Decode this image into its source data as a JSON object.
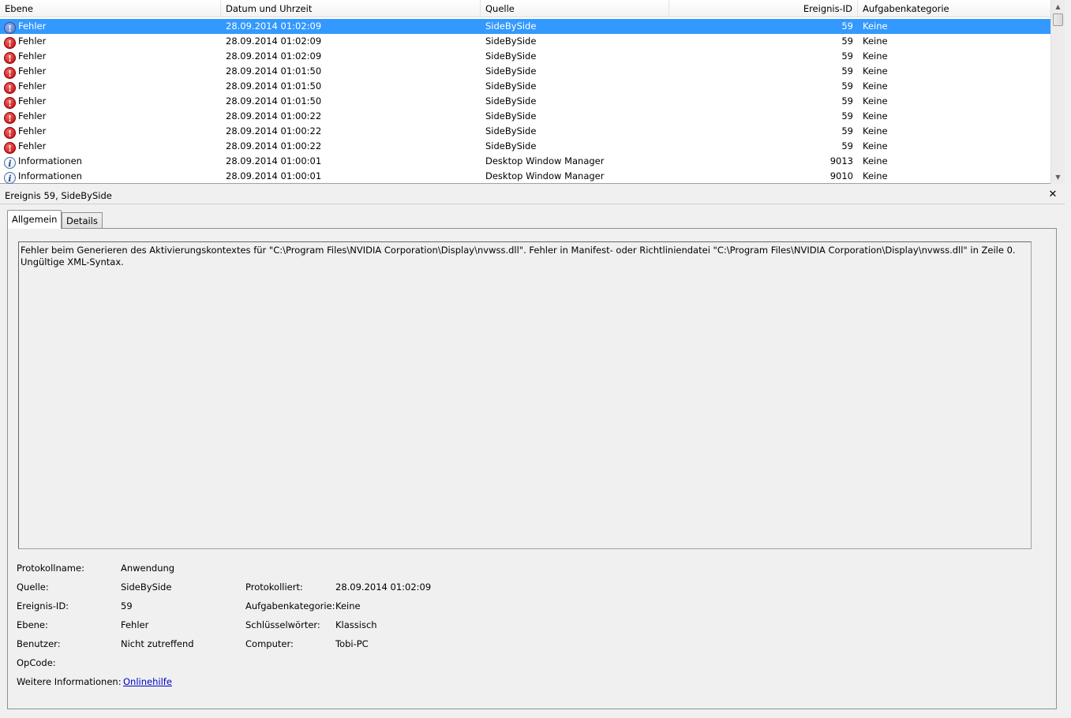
{
  "list": {
    "columns": {
      "level": "Ebene",
      "date": "Datum und Uhrzeit",
      "source": "Quelle",
      "event_id": "Ereignis-ID",
      "category": "Aufgabenkategorie"
    },
    "rows": [
      {
        "level": "Fehler",
        "type": "error",
        "date": "28.09.2014 01:02:09",
        "source": "SideBySide",
        "event_id": "59",
        "category": "Keine",
        "selected": true
      },
      {
        "level": "Fehler",
        "type": "error",
        "date": "28.09.2014 01:02:09",
        "source": "SideBySide",
        "event_id": "59",
        "category": "Keine"
      },
      {
        "level": "Fehler",
        "type": "error",
        "date": "28.09.2014 01:02:09",
        "source": "SideBySide",
        "event_id": "59",
        "category": "Keine"
      },
      {
        "level": "Fehler",
        "type": "error",
        "date": "28.09.2014 01:01:50",
        "source": "SideBySide",
        "event_id": "59",
        "category": "Keine"
      },
      {
        "level": "Fehler",
        "type": "error",
        "date": "28.09.2014 01:01:50",
        "source": "SideBySide",
        "event_id": "59",
        "category": "Keine"
      },
      {
        "level": "Fehler",
        "type": "error",
        "date": "28.09.2014 01:01:50",
        "source": "SideBySide",
        "event_id": "59",
        "category": "Keine"
      },
      {
        "level": "Fehler",
        "type": "error",
        "date": "28.09.2014 01:00:22",
        "source": "SideBySide",
        "event_id": "59",
        "category": "Keine"
      },
      {
        "level": "Fehler",
        "type": "error",
        "date": "28.09.2014 01:00:22",
        "source": "SideBySide",
        "event_id": "59",
        "category": "Keine"
      },
      {
        "level": "Fehler",
        "type": "error",
        "date": "28.09.2014 01:00:22",
        "source": "SideBySide",
        "event_id": "59",
        "category": "Keine"
      },
      {
        "level": "Informationen",
        "type": "info",
        "date": "28.09.2014 01:00:01",
        "source": "Desktop Window Manager",
        "event_id": "9013",
        "category": "Keine"
      },
      {
        "level": "Informationen",
        "type": "info",
        "date": "28.09.2014 01:00:01",
        "source": "Desktop Window Manager",
        "event_id": "9010",
        "category": "Keine"
      }
    ],
    "icons": {
      "error": "error-icon",
      "info": "info-icon"
    }
  },
  "detail": {
    "title": "Ereignis 59, SideBySide",
    "close_icon": "close-icon",
    "tabs": {
      "general": "Allgemein",
      "details": "Details"
    },
    "message": "Fehler beim Generieren des Aktivierungskontextes für \"C:\\Program Files\\NVIDIA Corporation\\Display\\nvwss.dll\". Fehler in Manifest- oder Richtliniendatei \"C:\\Program Files\\NVIDIA Corporation\\Display\\nvwss.dll\" in Zeile 0. Ungültige XML-Syntax.",
    "fields": {
      "log_name_label": "Protokollname:",
      "log_name": "Anwendung",
      "source_label": "Quelle:",
      "source": "SideBySide",
      "logged_label": "Protokolliert:",
      "logged": "28.09.2014 01:02:09",
      "event_id_label": "Ereignis-ID:",
      "event_id": "59",
      "category_label": "Aufgabenkategorie:",
      "category": "Keine",
      "level_label": "Ebene:",
      "level": "Fehler",
      "keywords_label": "Schlüsselwörter:",
      "keywords": "Klassisch",
      "user_label": "Benutzer:",
      "user": "Nicht zutreffend",
      "computer_label": "Computer:",
      "computer": "Tobi-PC",
      "opcode_label": "OpCode:",
      "opcode": "",
      "more_info_label": "Weitere Informationen:",
      "more_info_link": "Onlinehilfe"
    }
  },
  "colors": {
    "selection": "#3399ff",
    "link": "#0000cc"
  }
}
